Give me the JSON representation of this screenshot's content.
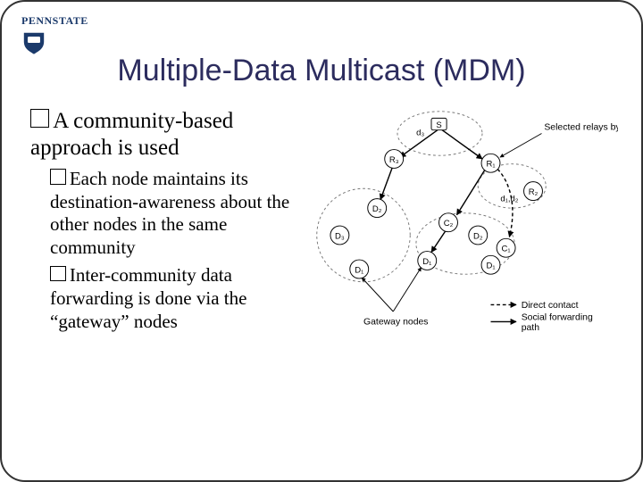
{
  "logo": {
    "wordmark": "PENNSTATE"
  },
  "title": "Multiple-Data Multicast (MDM)",
  "bullets": {
    "main": "A community-based approach is used",
    "sub1": "Each node maintains its destination-awareness about the other nodes in the same community",
    "sub2": "Inter-community data forwarding is done via the “gateway” nodes"
  },
  "figure": {
    "nodes": {
      "S": "S",
      "R1": "R₁",
      "R2": "R₂",
      "R3": "R₃",
      "D1a": "D₁",
      "D1b": "D₁",
      "D2a": "D₂",
      "D2b": "D₂",
      "D3": "D₃",
      "C1": "C₁",
      "C2": "C₂",
      "d1": "d₁",
      "d2": "d₂",
      "d3": "d₃"
    },
    "labels": {
      "selected_relays": "Selected relays by S",
      "gateway": "Gateway nodes",
      "direct": "Direct contact",
      "social": "Social forwarding path"
    }
  }
}
